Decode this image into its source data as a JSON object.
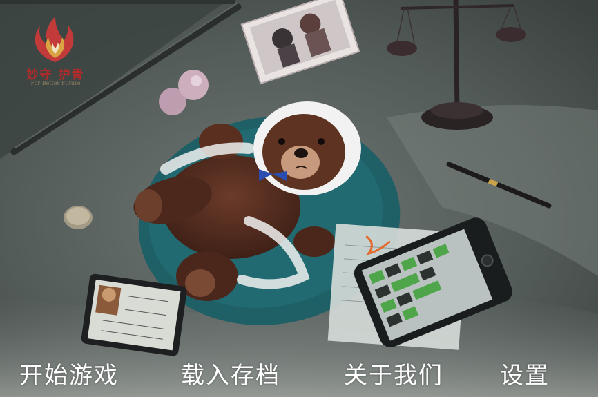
{
  "logo": {
    "title": "妙守 护青",
    "subtitle": "For Better Future",
    "colors": {
      "primary": "#c23a3a",
      "accent": "#d9a441"
    }
  },
  "menu": {
    "items": [
      {
        "label": "开始游戏"
      },
      {
        "label": "载入存档"
      },
      {
        "label": "关于我们"
      },
      {
        "label": "设置"
      }
    ],
    "text_color": "#ffffff"
  },
  "scene": {
    "background_color": "#4a5250"
  }
}
